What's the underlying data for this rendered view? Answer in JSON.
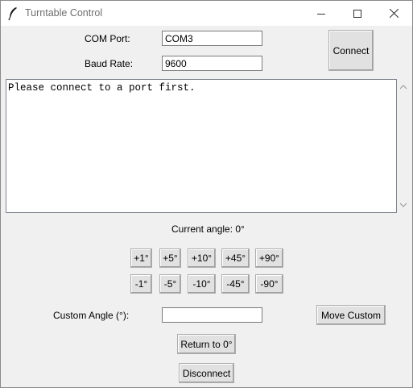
{
  "window": {
    "title": "Turntable Control",
    "controls": {
      "minimize": "—",
      "maximize": "☐",
      "close": "✕"
    }
  },
  "connection": {
    "com_port_label": "COM Port:",
    "com_port_value": "COM3",
    "baud_rate_label": "Baud Rate:",
    "baud_rate_value": "9600",
    "connect_label": "Connect"
  },
  "log": {
    "text": "Please connect to a port first."
  },
  "status": {
    "current_angle": "Current angle: 0°"
  },
  "steps": {
    "positive": [
      "+1°",
      "+5°",
      "+10°",
      "+45°",
      "+90°"
    ],
    "negative": [
      "-1°",
      "-5°",
      "-10°",
      "-45°",
      "-90°"
    ]
  },
  "custom": {
    "label": "Custom Angle (°):",
    "value": "",
    "move_label": "Move Custom"
  },
  "actions": {
    "return_label": "Return to 0°",
    "disconnect_label": "Disconnect"
  }
}
